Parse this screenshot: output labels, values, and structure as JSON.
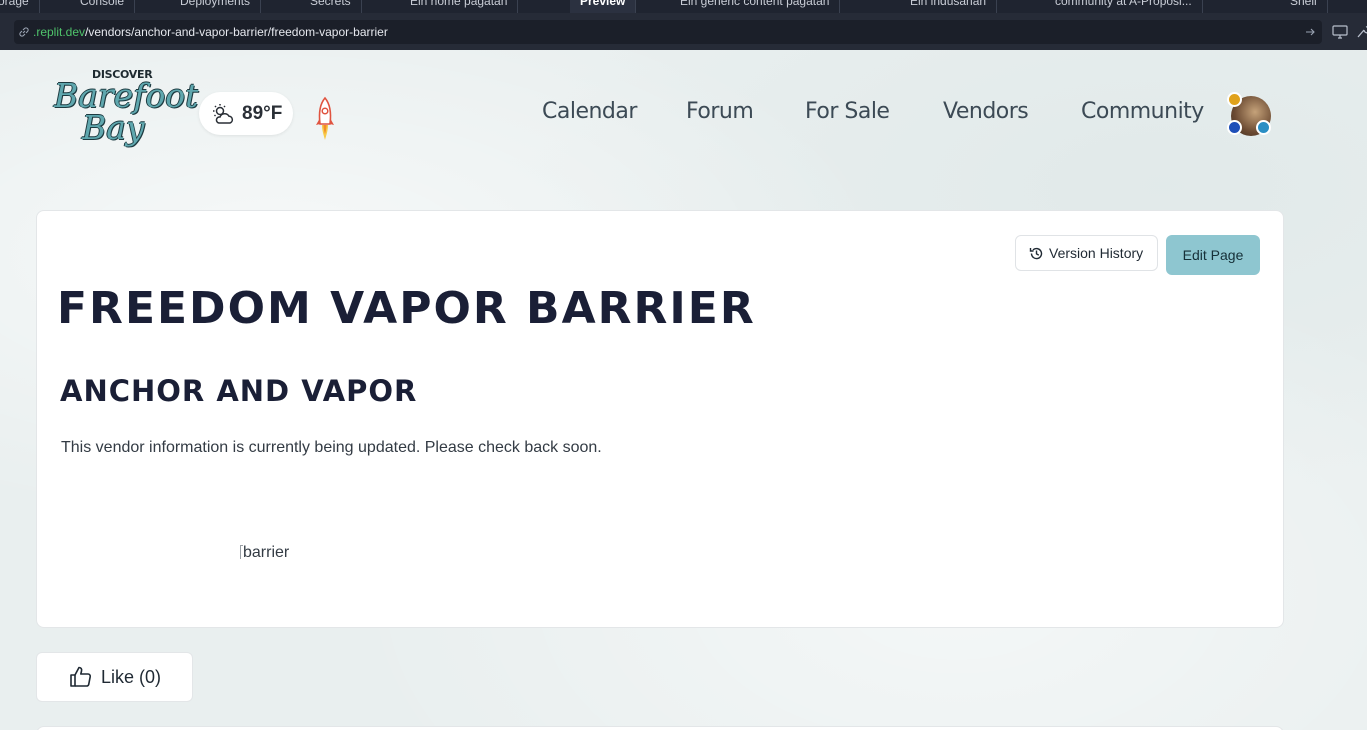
{
  "browser": {
    "tabs": [
      {
        "label": "orage",
        "active": false
      },
      {
        "label": "Console",
        "active": false
      },
      {
        "label": "Deployments",
        "active": false
      },
      {
        "label": "Secrets",
        "active": false
      },
      {
        "label": "Ein home pagatan",
        "active": false
      },
      {
        "label": "Preview",
        "active": true
      },
      {
        "label": "Ein generic content pagatan",
        "active": false
      },
      {
        "label": "Ein indusanan",
        "active": false
      },
      {
        "label": "community at A-Proposi...",
        "active": false
      },
      {
        "label": "Shell",
        "active": false
      }
    ],
    "url_host": ".replit.dev",
    "url_path": "/vendors/anchor-and-vapor-barrier/freedom-vapor-barrier"
  },
  "header": {
    "logo_top": "DISCOVER",
    "logo_line1": "Barefoot",
    "logo_line2": "Bay",
    "weather_temp": "89°F",
    "nav": [
      "Calendar",
      "Forum",
      "For Sale",
      "Vendors",
      "Community"
    ]
  },
  "content": {
    "version_history_label": "Version History",
    "edit_page_label": "Edit Page",
    "title": "FREEDOM VAPOR BARRIER",
    "subtitle": "ANCHOR AND VAPOR",
    "body": "This vendor information is currently being updated. Please check back soon.",
    "image_alt": "barrier"
  },
  "like": {
    "label": "Like (0)"
  },
  "colors": {
    "accent": "#8ec6d0",
    "title": "#1a1f36",
    "url_host": "#4fc36b"
  }
}
